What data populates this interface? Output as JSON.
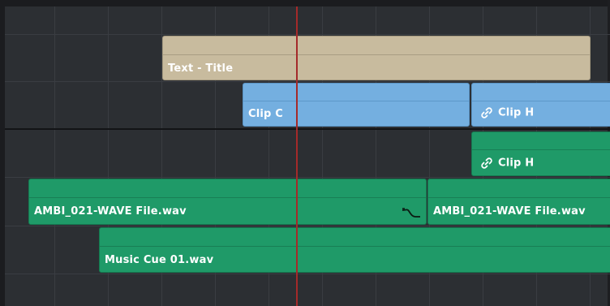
{
  "tracks": {
    "title_clip": {
      "name": "Text - Title"
    },
    "video_clips": [
      {
        "name": "Clip C",
        "linked": false
      },
      {
        "name": "Clip H",
        "linked": true
      }
    ],
    "linked_audio_clip": {
      "name": "Clip H",
      "linked": true
    },
    "audio_clips": [
      {
        "name": "AMBI_021-WAVE File.wav"
      },
      {
        "name": "AMBI_021-WAVE File.wav"
      }
    ],
    "music_clip": {
      "name": "Music Cue 01.wav"
    }
  },
  "icons": {
    "link": "link-icon",
    "fade_curve": "fade-curve-icon"
  },
  "colors": {
    "background": "#2c2f33",
    "title_clip": "#c8bb9e",
    "video_clip": "#74afe0",
    "audio_clip": "#1f9a68",
    "playhead": "#a52a2a"
  }
}
